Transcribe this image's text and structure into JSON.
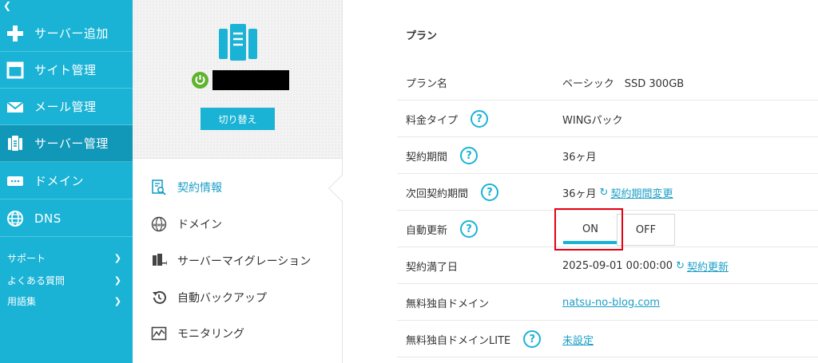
{
  "sidebar": {
    "collapse_icon": "chevron-left-icon",
    "items": [
      {
        "label": "サーバー追加",
        "icon": "plus-icon"
      },
      {
        "label": "サイト管理",
        "icon": "window-icon"
      },
      {
        "label": "メール管理",
        "icon": "mail-icon"
      },
      {
        "label": "サーバー管理",
        "icon": "server-icon",
        "active": true
      },
      {
        "label": "ドメイン",
        "icon": "domain-icon"
      },
      {
        "label": "DNS",
        "icon": "globe-icon"
      }
    ],
    "sub_items": [
      {
        "label": "サポート"
      },
      {
        "label": "よくある質問"
      },
      {
        "label": "用語集"
      }
    ]
  },
  "server_panel": {
    "switch_label": "切り替え",
    "menu": [
      {
        "label": "契約情報",
        "icon": "contract-search-icon",
        "active": true
      },
      {
        "label": "ドメイン",
        "icon": "www-globe-icon"
      },
      {
        "label": "サーバーマイグレーション",
        "icon": "migration-icon"
      },
      {
        "label": "自動バックアップ",
        "icon": "history-icon"
      },
      {
        "label": "モニタリング",
        "icon": "monitoring-icon"
      }
    ]
  },
  "plan": {
    "title": "プラン",
    "rows": [
      {
        "label": "プラン名",
        "value": "ベーシック　SSD 300GB"
      },
      {
        "label": "料金タイプ",
        "value": "WINGパック"
      },
      {
        "label": "契約期間",
        "value": "36ヶ月"
      },
      {
        "label": "次回契約期間",
        "value": "36ヶ月",
        "link": "契約期間変更"
      },
      {
        "label": "自動更新"
      },
      {
        "label": "契約満了日",
        "value": "2025-09-01 00:00:00",
        "link": "契約更新"
      },
      {
        "label": "無料独自ドメイン",
        "link": "natsu-no-blog.com"
      },
      {
        "label": "無料独自ドメインLITE",
        "link": "未設定"
      }
    ],
    "help_glyph": "?",
    "refresh_glyph": "↻",
    "auto_renew": {
      "on_label": "ON",
      "off_label": "OFF",
      "selected": "ON"
    }
  },
  "colors": {
    "sidebar_bg": "#1ab3d6",
    "sidebar_active": "#1197b8",
    "accent": "#1ab3d6",
    "link": "#1a9fc7",
    "highlight": "#e60012",
    "power_green": "#5fb32e"
  }
}
